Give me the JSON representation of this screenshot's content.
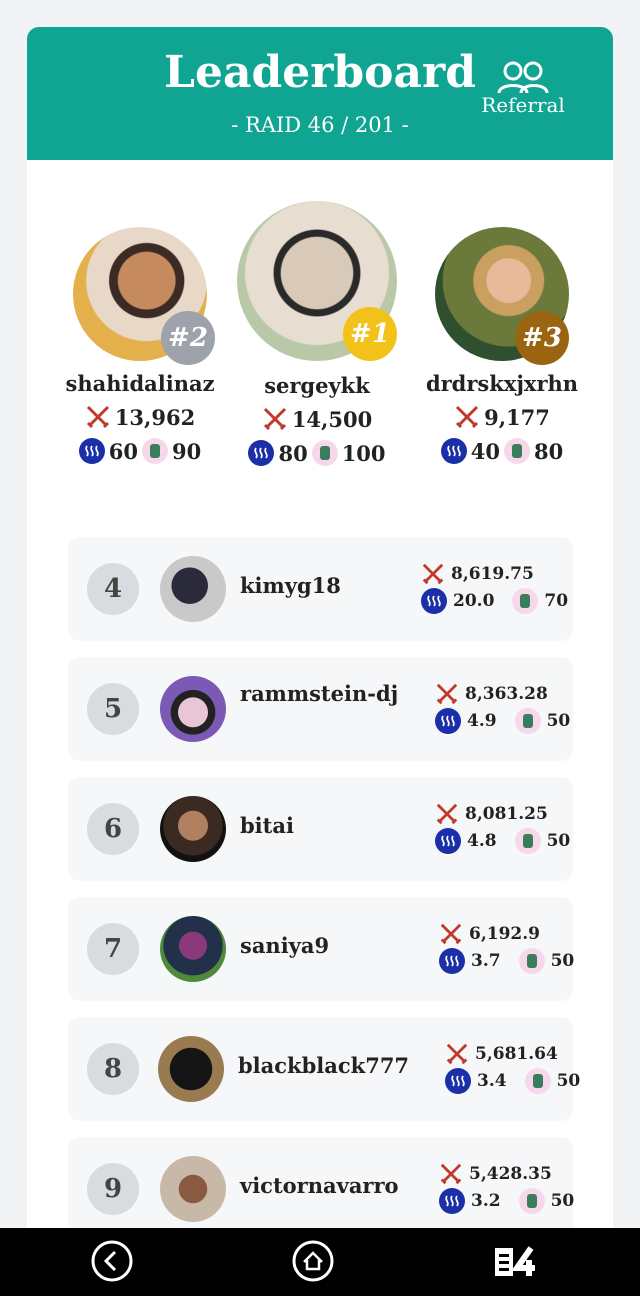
{
  "header": {
    "title": "Leaderboard",
    "subtitle": "- RAID 46 / 201 -",
    "referral_label": "Referral",
    "color": "#0fa592"
  },
  "podium": [
    {
      "place": 2,
      "badge": "#2",
      "name": "shahidalinaz",
      "damage": "13,962",
      "steem": "60",
      "cards": "90",
      "badge_color": "#9ea3ab"
    },
    {
      "place": 1,
      "badge": "#1",
      "name": "sergeykk",
      "damage": "14,500",
      "steem": "80",
      "cards": "100",
      "badge_color": "#f2c21a"
    },
    {
      "place": 3,
      "badge": "#3",
      "name": "drdrskxjxrhn",
      "damage": "9,177",
      "steem": "40",
      "cards": "80",
      "badge_color": "#9a6410"
    }
  ],
  "rows": [
    {
      "rank": "4",
      "name": "kimyg18",
      "damage": "8,619.75",
      "steem": "20.0",
      "cards": "70"
    },
    {
      "rank": "5",
      "name": "rammstein-dj",
      "damage": "8,363.28",
      "steem": "4.9",
      "cards": "50"
    },
    {
      "rank": "6",
      "name": "bitai",
      "damage": "8,081.25",
      "steem": "4.8",
      "cards": "50"
    },
    {
      "rank": "7",
      "name": "saniya9",
      "damage": "6,192.9",
      "steem": "3.7",
      "cards": "50"
    },
    {
      "rank": "8",
      "name": "blackblack777",
      "damage": "5,681.64",
      "steem": "3.4",
      "cards": "50"
    },
    {
      "rank": "9",
      "name": "victornavarro",
      "damage": "5,428.35",
      "steem": "3.2",
      "cards": "50"
    }
  ],
  "icons": {
    "damage": "crossed-swords-icon",
    "steem": "steem-token-icon",
    "cards": "card-reward-icon",
    "referral": "users-icon",
    "nav": [
      "back-icon",
      "home-icon",
      "app-logo-icon"
    ]
  },
  "colors": {
    "steem": "#1a2fa8",
    "sword": "#c0392b",
    "navbar": "#000000"
  }
}
